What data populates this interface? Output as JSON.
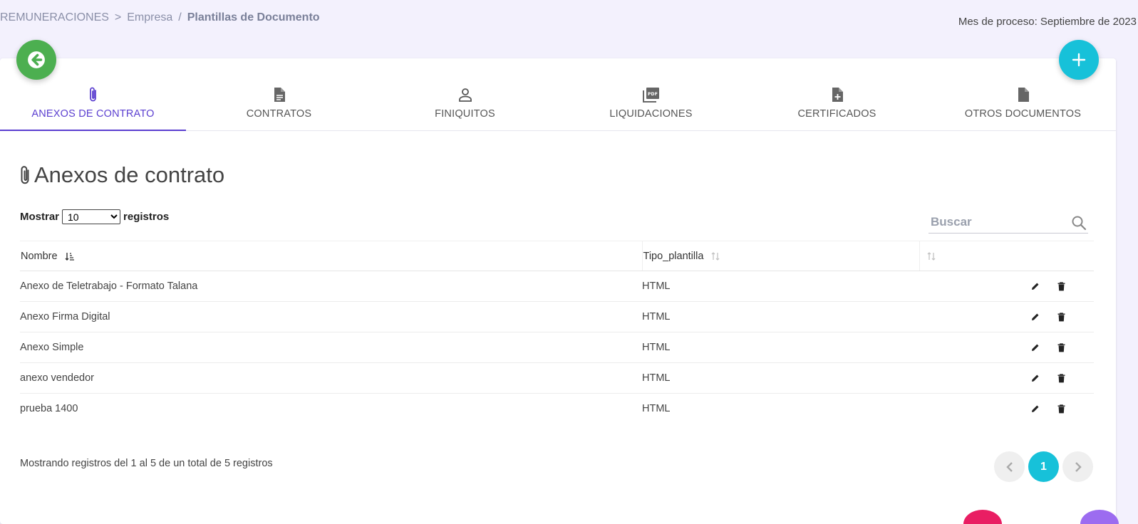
{
  "breadcrumb": {
    "root": "REMUNERACIONES",
    "sep1": ">",
    "company": "Empresa",
    "sep2": "/",
    "current": "Plantillas de Documento"
  },
  "process_month": "Mes de proceso: Septiembre de 2023",
  "buttons": {
    "back_icon": "arrow-left-icon",
    "add_label": "+"
  },
  "tabs": [
    {
      "label": "ANEXOS DE CONTRATO",
      "icon": "paperclip-icon",
      "active": true
    },
    {
      "label": "CONTRATOS",
      "icon": "document-icon",
      "active": false
    },
    {
      "label": "FINIQUITOS",
      "icon": "person-icon",
      "active": false
    },
    {
      "label": "LIQUIDACIONES",
      "icon": "pdf-icon",
      "active": false
    },
    {
      "label": "CERTIFICADOS",
      "icon": "document-plus-icon",
      "active": false
    },
    {
      "label": "OTROS DOCUMENTOS",
      "icon": "file-icon",
      "active": false
    }
  ],
  "section": {
    "title": "Anexos de contrato"
  },
  "length_control": {
    "prefix": "Mostrar",
    "value": "10",
    "suffix": "registros"
  },
  "search": {
    "placeholder": "Buscar"
  },
  "table": {
    "headers": [
      "Nombre",
      "Tipo_plantilla",
      ""
    ],
    "rows": [
      {
        "name": "Anexo de Teletrabajo - Formato Talana",
        "type": "HTML"
      },
      {
        "name": "Anexo Firma Digital",
        "type": "HTML"
      },
      {
        "name": "Anexo Simple",
        "type": "HTML"
      },
      {
        "name": "anexo vendedor",
        "type": "HTML"
      },
      {
        "name": "prueba 1400",
        "type": "HTML"
      }
    ]
  },
  "info": "Mostrando registros del 1 al 5 de un total de 5 registros",
  "pagination": {
    "current_page": "1"
  },
  "colors": {
    "accent": "#5b3fd0",
    "back_button": "#4caf50",
    "add_button": "#17c1d9",
    "page_current": "#17c1d9"
  }
}
